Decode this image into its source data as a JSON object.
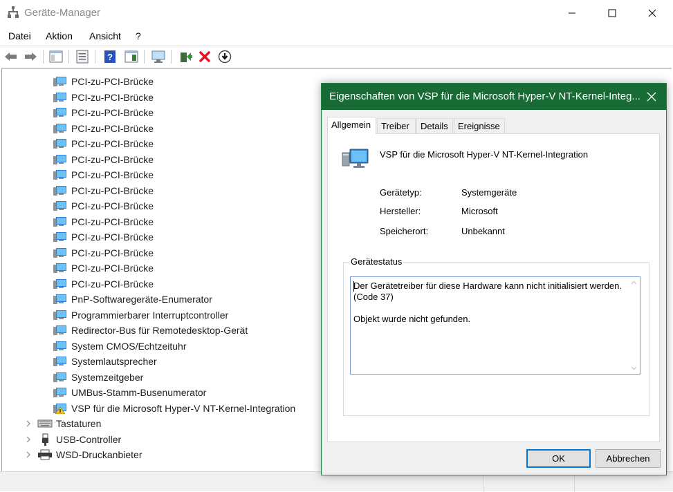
{
  "window": {
    "title": "Geräte-Manager"
  },
  "menu": [
    "Datei",
    "Aktion",
    "Ansicht",
    "?"
  ],
  "toolbar": {
    "icons": [
      "back-arrow-icon",
      "forward-arrow-icon",
      "console-tree-icon",
      "properties-icon",
      "help-icon",
      "show-hide-icon",
      "scan-hardware-icon",
      "update-driver-icon",
      "uninstall-icon",
      "disable-device-icon"
    ]
  },
  "tree": {
    "system_devices": [
      "PCI-zu-PCI-Brücke",
      "PCI-zu-PCI-Brücke",
      "PCI-zu-PCI-Brücke",
      "PCI-zu-PCI-Brücke",
      "PCI-zu-PCI-Brücke",
      "PCI-zu-PCI-Brücke",
      "PCI-zu-PCI-Brücke",
      "PCI-zu-PCI-Brücke",
      "PCI-zu-PCI-Brücke",
      "PCI-zu-PCI-Brücke",
      "PCI-zu-PCI-Brücke",
      "PCI-zu-PCI-Brücke",
      "PCI-zu-PCI-Brücke",
      "PCI-zu-PCI-Brücke",
      "PnP-Softwaregeräte-Enumerator",
      "Programmierbarer Interruptcontroller",
      "Redirector-Bus für Remotedesktop-Gerät",
      "System CMOS/Echtzeituhr",
      "Systemlautsprecher",
      "Systemzeitgeber",
      "UMBus-Stamm-Busenumerator",
      "VSP für die Microsoft Hyper-V NT-Kernel-Integration"
    ],
    "categories": [
      "Tastaturen",
      "USB-Controller",
      "WSD-Druckanbieter"
    ]
  },
  "dialog": {
    "title": "Eigenschaften von VSP für die Microsoft Hyper-V NT-Kernel-Integ...",
    "tabs": [
      "Allgemein",
      "Treiber",
      "Details",
      "Ereignisse"
    ],
    "device_name": "VSP für die Microsoft Hyper-V NT-Kernel-Integration",
    "props": {
      "type_label": "Gerätetyp:",
      "type_value": "Systemgeräte",
      "vendor_label": "Hersteller:",
      "vendor_value": "Microsoft",
      "location_label": "Speicherort:",
      "location_value": "Unbekannt"
    },
    "status_title": "Gerätestatus",
    "status_text": "Der Gerätetreiber für diese Hardware kann nicht initialisiert werden.\n(Code 37)\n\nObjekt wurde nicht gefunden.",
    "ok_label": "OK",
    "cancel_label": "Abbrechen"
  },
  "colors": {
    "dialog_titlebar": "#186b34",
    "ok_border": "#0078d7",
    "warning": "#f5c518",
    "error_red": "#e81123"
  }
}
